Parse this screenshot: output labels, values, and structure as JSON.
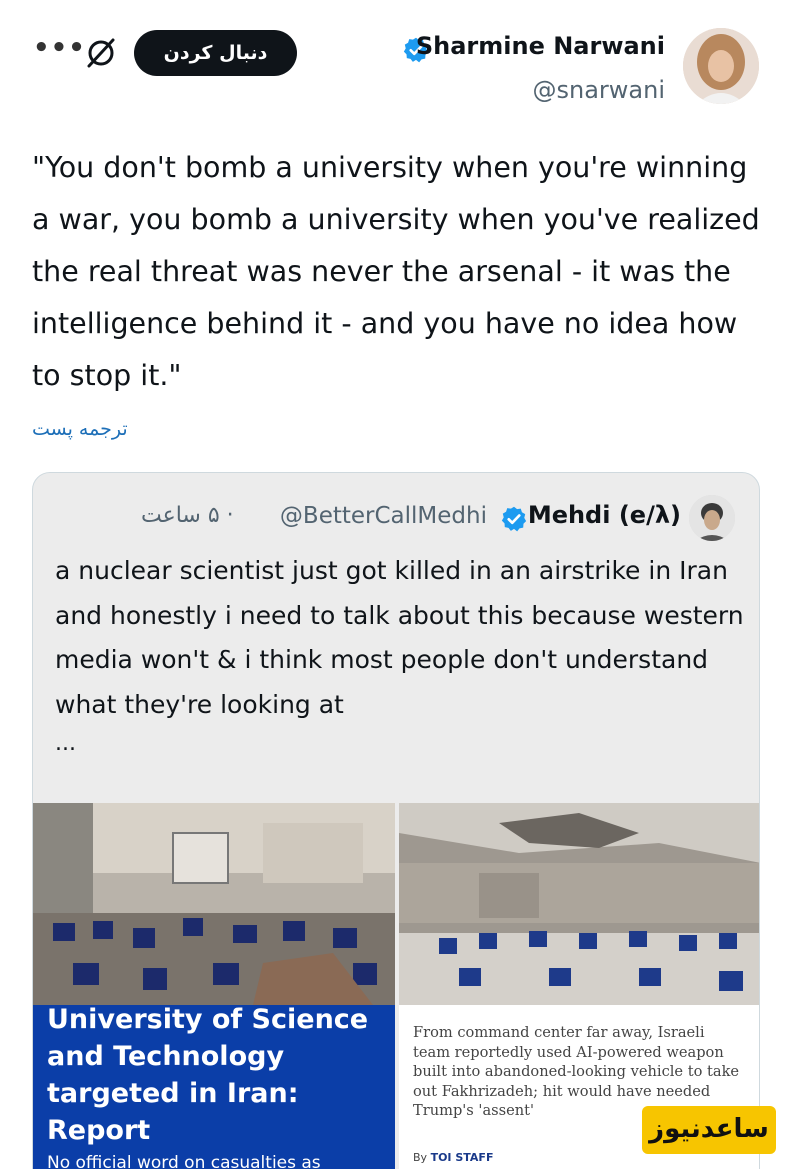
{
  "header": {
    "more_label": "•••",
    "follow_label": "دنبال کردن",
    "author_name": "Sharmine Narwani",
    "author_handle": "@snarwani"
  },
  "tweet": {
    "text": "\"You don't bomb a university when you're winning a war, you bomb a university when you've realized the real threat was never the arsenal - it was the intelligence behind it - and you have no idea how to stop it.\"",
    "translate_label": "ترجمه پست"
  },
  "quote": {
    "name": "Mehdi (e/λ)",
    "handle": "@BetterCallMedhi",
    "time": "· ۵ ساعت",
    "text": "a nuclear scientist just got killed in an airstrike in Iran and honestly i need to talk about this because western media won't & i think most people don't understand what they're looking at",
    "ellipsis": "...",
    "article_left": {
      "title": "University of Science and Technology targeted in Iran: Report",
      "subtitle": "No official word on casualties as"
    },
    "article_right": {
      "description": "From command center far away, Israeli team reportedly used AI-powered weapon built into abandoned-looking vehicle to take out Fakhrizadeh; hit would have needed Trump's 'assent'",
      "byline_prefix": "By",
      "byline_author": "TOI STAFF"
    }
  },
  "watermark": {
    "text": "ساعدنیوز"
  },
  "colors": {
    "verified": "#1d9bf0",
    "follow_bg": "#0f1419",
    "link": "#1d6fb8",
    "card_bg": "#ececec",
    "article_blue": "#0b3ea8",
    "watermark_bg": "#f7c500"
  },
  "icons": {
    "mute": "bell-slash-icon",
    "verified": "verified-badge-icon"
  }
}
